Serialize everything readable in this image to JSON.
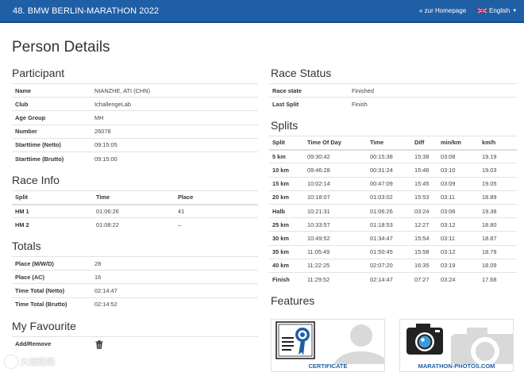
{
  "header": {
    "title": "48. BMW BERLIN-MARATHON 2022",
    "home_link": "« zur Homepage",
    "language": "English"
  },
  "page_title": "Person Details",
  "participant": {
    "heading": "Participant",
    "rows": [
      {
        "label": "Name",
        "value": "NIANZHE, ATI (CHN)"
      },
      {
        "label": "Club",
        "value": "IchallengeLab"
      },
      {
        "label": "Age Group",
        "value": "MH"
      },
      {
        "label": "Number",
        "value": "26078"
      },
      {
        "label": "Starttime (Netto)",
        "value": "09:15:05"
      },
      {
        "label": "Starttime (Brutto)",
        "value": "09:15:00"
      }
    ]
  },
  "race_info": {
    "heading": "Race Info",
    "columns": [
      "Split",
      "Time",
      "Place"
    ],
    "rows": [
      [
        "HM 1",
        "01:06:26",
        "41"
      ],
      [
        "HM 2",
        "01:08:22",
        "–"
      ]
    ]
  },
  "totals": {
    "heading": "Totals",
    "rows": [
      {
        "label": "Place (M/W/D)",
        "value": "28"
      },
      {
        "label": "Place (AC)",
        "value": "16"
      },
      {
        "label": "Time Total (Netto)",
        "value": "02:14:47"
      },
      {
        "label": "Time Total (Brutto)",
        "value": "02:14:52"
      }
    ]
  },
  "favourite": {
    "heading": "My Favourite",
    "label": "Add/Remove",
    "icon": "trash-icon"
  },
  "race_status": {
    "heading": "Race Status",
    "rows": [
      {
        "label": "Race state",
        "value": "Finished"
      },
      {
        "label": "Last Split",
        "value": "Finish"
      }
    ]
  },
  "splits": {
    "heading": "Splits",
    "columns": [
      "Split",
      "Time Of Day",
      "Time",
      "Diff",
      "min/km",
      "km/h"
    ],
    "rows": [
      [
        "5 km",
        "09:30:42",
        "00:15:38",
        "15:38",
        "03:08",
        "19.19"
      ],
      [
        "10 km",
        "09:46:28",
        "00:31:24",
        "15:46",
        "03:10",
        "19.03"
      ],
      [
        "15 km",
        "10:02:14",
        "00:47:09",
        "15:45",
        "03:09",
        "19.05"
      ],
      [
        "20 km",
        "10:18:07",
        "01:03:02",
        "15:53",
        "03:11",
        "18.89"
      ],
      [
        "Halb",
        "10:21:31",
        "01:06:26",
        "03:24",
        "03:06",
        "19.38"
      ],
      [
        "25 km",
        "10:33:57",
        "01:18:53",
        "12:27",
        "03:12",
        "18.80"
      ],
      [
        "30 km",
        "10:49:52",
        "01:34:47",
        "15:54",
        "03:11",
        "18.87"
      ],
      [
        "35 km",
        "11:05:49",
        "01:50:45",
        "15:58",
        "03:12",
        "18.79"
      ],
      [
        "40 km",
        "11:22:25",
        "02:07:20",
        "16:35",
        "03:19",
        "18.09"
      ],
      [
        "Finish",
        "11:29:52",
        "02:14:47",
        "07:27",
        "03:24",
        "17.68"
      ]
    ]
  },
  "features": {
    "heading": "Features",
    "cards": [
      {
        "caption": "CERTIFICATE",
        "icon": "certificate-icon"
      },
      {
        "caption": "MARATHON-PHOTOS.COM",
        "icon": "camera-icon"
      }
    ]
  },
  "watermark": {
    "text": "大蝦跑購"
  },
  "colors": {
    "header": "#1f5fa6",
    "link": "#1f5fa6"
  }
}
